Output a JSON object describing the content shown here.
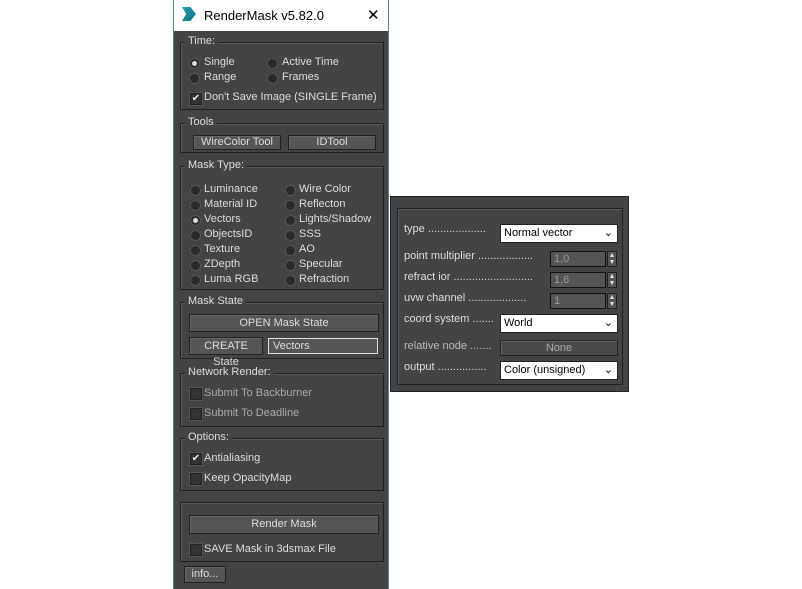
{
  "window": {
    "title": "RenderMask v5.82.0",
    "close": "✕",
    "icon": "3dsmax-logo-icon"
  },
  "time": {
    "label": "Time:",
    "options": [
      "Single",
      "Active Time",
      "Range",
      "Frames"
    ],
    "selected": "Single",
    "dont_save": "Don't Save Image (SINGLE Frame)",
    "dont_save_checked": true
  },
  "tools": {
    "label": "Tools",
    "buttons": [
      "WireColor Tool",
      "IDTool"
    ]
  },
  "mask_type": {
    "label": "Mask Type:",
    "left": [
      "Luminance",
      "Material ID",
      "Vectors",
      "ObjectsID",
      "Texture",
      "ZDepth",
      "Luma RGB"
    ],
    "right": [
      "Wire Color",
      "Reflecton",
      "Lights/Shadow",
      "SSS",
      "AO",
      "Specular",
      "Refraction"
    ],
    "selected": "Vectors"
  },
  "mask_state": {
    "label": "Mask State",
    "open": "OPEN Mask State",
    "create": "CREATE State",
    "name_value": "Vectors"
  },
  "network": {
    "label": "Network Render:",
    "backburner": "Submit To Backburner",
    "deadline": "Submit To Deadline"
  },
  "options": {
    "label": "Options:",
    "antialiasing": "Antialiasing",
    "antialiasing_checked": true,
    "keep_opacity": "Keep OpacityMap"
  },
  "render": {
    "button": "Render Mask",
    "save": "SAVE Mask in 3dsmax File",
    "info": "info..."
  },
  "vectors": {
    "type_label": "type ...................",
    "type_value": "Normal vector",
    "point_label": "point multiplier ..................",
    "point_value": "1,0",
    "ior_label": "refract ior ..........................",
    "ior_value": "1,6",
    "uvw_label": "uvw channel ...................",
    "uvw_value": "1",
    "coord_label": "coord system .......",
    "coord_value": "World",
    "node_label": "relative node .......",
    "node_value": "None",
    "output_label": "output ................",
    "output_value": "Color (unsigned)"
  }
}
